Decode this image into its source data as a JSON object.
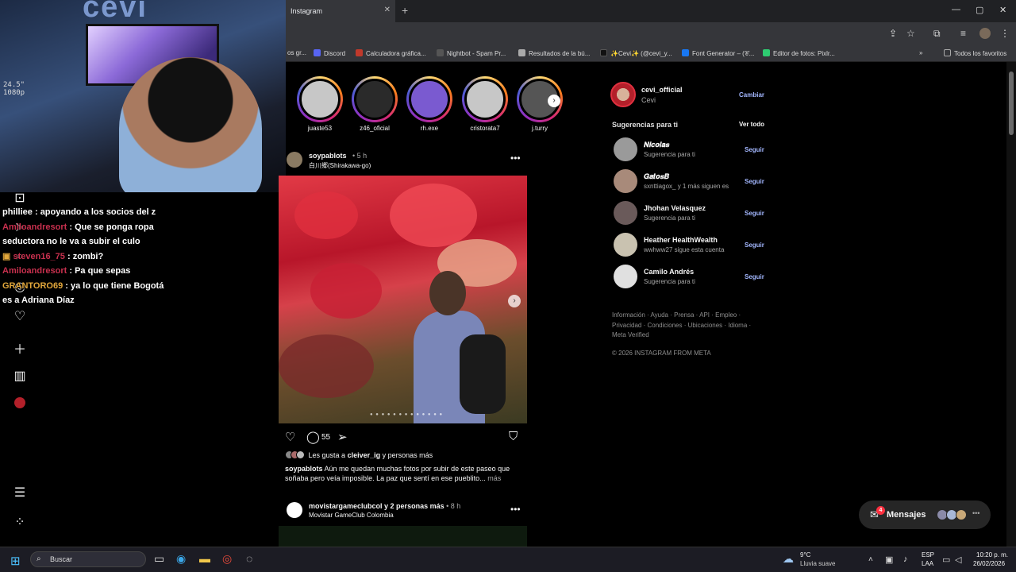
{
  "browser": {
    "tab_title": "Instagram",
    "tab_close": "✕",
    "new_tab": "+",
    "window_controls": [
      "—",
      "▢",
      "✕"
    ],
    "bookmarks": [
      {
        "label": "os gr...",
        "icon": "bookmark-icon",
        "color": "#888888"
      },
      {
        "label": "Discord",
        "icon": "discord-icon",
        "color": "#5865f2"
      },
      {
        "label": "Calculadora gráfica...",
        "icon": "calculator-icon",
        "color": "#c0392b"
      },
      {
        "label": "Nightbot - Spam Pr...",
        "icon": "nightbot-icon",
        "color": "#555555"
      },
      {
        "label": "Resultados de la bú...",
        "icon": "document-icon",
        "color": "#aaaaaa"
      },
      {
        "label": "✨Cevi✨ (@cevi_y...",
        "icon": "tiktok-icon",
        "color": "#111111"
      },
      {
        "label": "Font Generator – (𝒞...",
        "icon": "facebook-icon",
        "color": "#1877f2"
      },
      {
        "label": "Editor de fotos: Pixlr...",
        "icon": "pixlr-icon",
        "color": "#2ecc71"
      },
      {
        "label": "»",
        "icon": "chevron-right-icon",
        "color": "#888888"
      },
      {
        "label": "Todos los favoritos",
        "icon": "folder-icon",
        "color": "#888888"
      }
    ]
  },
  "overlay": {
    "cam_resolution": [
      "24.5\"",
      "1080p"
    ],
    "cam_logo": "cevi",
    "chat": [
      {
        "user": "philliee",
        "message": "apoyando a los socios del z",
        "color": "#ffffff"
      },
      {
        "user": "Amiloandresort",
        "message": "Que se ponga ropa seductora no le va a subir el culo",
        "color": "#c8304e"
      },
      {
        "user": "steven16_75",
        "message": "zombi?",
        "color": "#c8304e"
      },
      {
        "user": "Amiloandresort",
        "message": "Pa que sepas",
        "color": "#c8304e"
      },
      {
        "user": "GRANTORO69",
        "message": "ya lo que tiene Bogotá es a Adriana Díaz",
        "color": "#e2a73b"
      }
    ]
  },
  "sidebar_icons": [
    "reels-icon",
    "messages-icon",
    "search-icon",
    "explore-icon",
    "notifications-icon",
    "create-icon",
    "dashboard-icon",
    "profile-icon",
    "menu-icon",
    "apps-icon"
  ],
  "stories": [
    {
      "name": "juaste53"
    },
    {
      "name": "z46_oficial"
    },
    {
      "name": "rh.exe"
    },
    {
      "name": "cristorata7"
    },
    {
      "name": "j.turry"
    }
  ],
  "post": {
    "user": "soypablots",
    "time": "• 5 h",
    "location": "白川郷(Shirakawa-go)",
    "comments": "55",
    "likes_prefix": "Les gusta a",
    "likes_user": "cleiver_ig",
    "likes_suffix": "y personas más",
    "caption_user": "soypablots",
    "caption": "Aún me quedan muchas fotos por subir de este paseo que soñaba pero veía imposible. La paz que sentí en ese pueblito...",
    "more": "más",
    "dots": "● ● ● ● ● ● ● ● ● ● ● ● ●"
  },
  "next_post": {
    "user": "movistargameclubcol",
    "user_suffix": "y 2 personas más",
    "time": "• 8 h",
    "subtitle": "Movistar GameClub Colombia"
  },
  "profile": {
    "username": "cevi_official",
    "name": "Cevi",
    "switch": "Cambiar"
  },
  "suggestions": {
    "title": "Sugerencias para ti",
    "see_all": "Ver todo",
    "follow": "Seguir",
    "items": [
      {
        "user": "𝑵𝒊𝒄𝒐𝒍𝒂𝒔",
        "sub": "Sugerencia para ti"
      },
      {
        "user": "𝑮𝒂𝒕𝒐𝒔𝑩",
        "sub": "sxnttiagox_ y 1 más siguen es"
      },
      {
        "user": "Jhohan Velasquez",
        "sub": "Sugerencia para ti"
      },
      {
        "user": "Heather HealthWealth",
        "sub": "wwhww27 sigue esta cuenta"
      },
      {
        "user": "Camilo Andrés",
        "sub": "Sugerencia para ti"
      }
    ]
  },
  "footer": {
    "links": "Información · Ayuda · Prensa · API · Empleo · Privacidad · Condiciones · Ubicaciones · Idioma · Meta Verified",
    "copyright": "© 2026 INSTAGRAM FROM META"
  },
  "messages": {
    "label": "Mensajes",
    "badge": "4"
  },
  "taskbar": {
    "search_placeholder": "Buscar",
    "temp": "9°C",
    "weather": "Lluvia suave",
    "lang1": "ESP",
    "lang2": "LAA",
    "time": "10:20 p. m.",
    "date": "26/02/2026"
  },
  "colors": {
    "accent": "#a3b7ff",
    "notification": "#ff3040"
  }
}
